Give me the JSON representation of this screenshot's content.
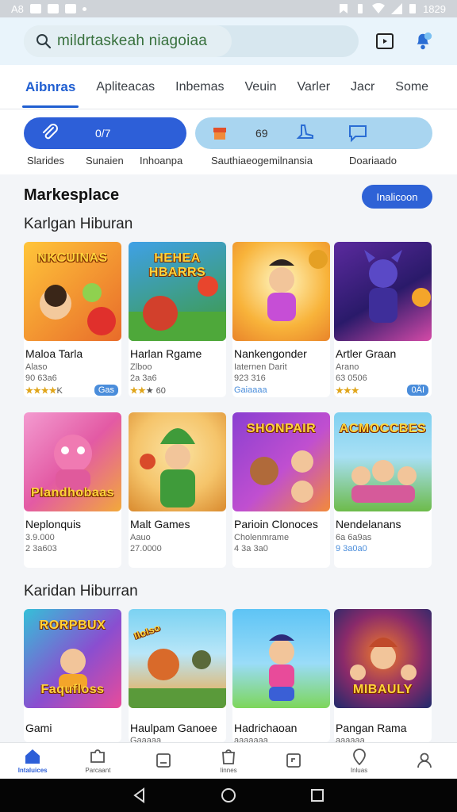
{
  "status_bar": {
    "left_text": "A8",
    "time": "1829"
  },
  "search": {
    "placeholder": "mildrtaskeah niagoiaa"
  },
  "tabs": [
    "Aibnras",
    "Apliteacas",
    "Inbemas",
    "Veuin",
    "Varler",
    "Jacr",
    "Some"
  ],
  "filters": {
    "blue_pill_count": "0/7",
    "light_pill_count": "69",
    "labels": [
      "Slarides",
      "Sunaien",
      "Inhoanpa",
      "Sauthiaeogemilnansia",
      "Doariaado"
    ]
  },
  "marketplace": {
    "title": "Markesplace",
    "button": "Inalicoon",
    "section1_title": "Karlgan Hiburan",
    "section2_title": "Karidan Hiburran"
  },
  "cards_row1": [
    {
      "name": "Maloa Tarla",
      "line2": "Alaso",
      "line3": "90 63a6",
      "rating": "★★★★",
      "rating_text": "K",
      "badge": "Gas",
      "art_title": "NKCUINAS",
      "bg1": "#ffc53a",
      "bg2": "#e86b2a"
    },
    {
      "name": "Harlan Rgame",
      "line2": "Zlboo",
      "line3": "2a 3a6",
      "rating": "★★",
      "rating_text": "★ 60",
      "badge": "",
      "art_title": "HEHEA HBARRS",
      "bg1": "#3fa0e6",
      "bg2": "#3d9b3d"
    },
    {
      "name": "Nankengonder",
      "line2": "Iaternen Darit",
      "line3": "923 316",
      "rating": "",
      "rating_text": "",
      "badge": "",
      "line3_extra": "Gaiaaaa",
      "art_title": "",
      "bg1": "#fde07a",
      "bg2": "#f59a26"
    },
    {
      "name": "Artler Graan",
      "line2": "Arano",
      "line3": "63 0506",
      "rating": "★★★",
      "rating_text": "",
      "badge": "0ÄI",
      "art_title": "",
      "bg1": "#5b2a9e",
      "bg2": "#d54aa7"
    }
  ],
  "cards_row2": [
    {
      "name": "Neplonquis",
      "line2": "3.9.000",
      "line3": "2 3a603",
      "art_title": "Plandhobaas",
      "bg1": "#f39bd0",
      "bg2": "#f2a93a"
    },
    {
      "name": "Malt Games",
      "line2": "Aauo",
      "line3": "27.0000",
      "art_title": "",
      "bg1": "#f5c46a",
      "bg2": "#d98a2e"
    },
    {
      "name": "Parioin Clonoces",
      "line2": "Cholenmrame",
      "line3": "4 3a 3a0",
      "art_title": "SHONPAIR",
      "bg1": "#8a3fd1",
      "bg2": "#f28a3a"
    },
    {
      "name": "Nendelanans",
      "line2": "6a 6a9as",
      "line3": "9 3a0a0",
      "art_title": "ACMOCCBES",
      "bg1": "#7fd0f0",
      "bg2": "#6dbb4a"
    }
  ],
  "cards_row3": [
    {
      "name": "Gami",
      "line2": "",
      "art_title": "RORPBUX",
      "art_title2": "Faqufloss",
      "bg1": "#35c0d8",
      "bg2": "#e84b9a"
    },
    {
      "name": "Haulpam Ganoee",
      "line2": "Gaaaaa",
      "art_title": "Ilolso",
      "bg1": "#7bd2f2",
      "bg2": "#f0a640"
    },
    {
      "name": "Hadrichaoan",
      "line2": "aaaaaaa",
      "art_title": "",
      "bg1": "#5ec4f5",
      "bg2": "#7dd65a"
    },
    {
      "name": "Pangan Rama",
      "line2": "aaaaaa",
      "art_title": "MIBAULY",
      "bg1": "#1f2a6b",
      "bg2": "#f07a2a"
    }
  ],
  "bottom_nav": [
    {
      "label": "Intaluices",
      "icon": "home-icon"
    },
    {
      "label": "Parcaant",
      "icon": "puzzle-icon"
    },
    {
      "label": "",
      "icon": "note-icon"
    },
    {
      "label": "Iinnes",
      "icon": "bag-icon"
    },
    {
      "label": "",
      "icon": "square-icon"
    },
    {
      "label": "Inluas",
      "icon": "pin-icon"
    },
    {
      "label": "",
      "icon": "profile-icon"
    }
  ],
  "colors": {
    "accent": "#2d5fd8",
    "light_pill": "#a9d5f0",
    "header_bg": "#e9f4fb"
  }
}
